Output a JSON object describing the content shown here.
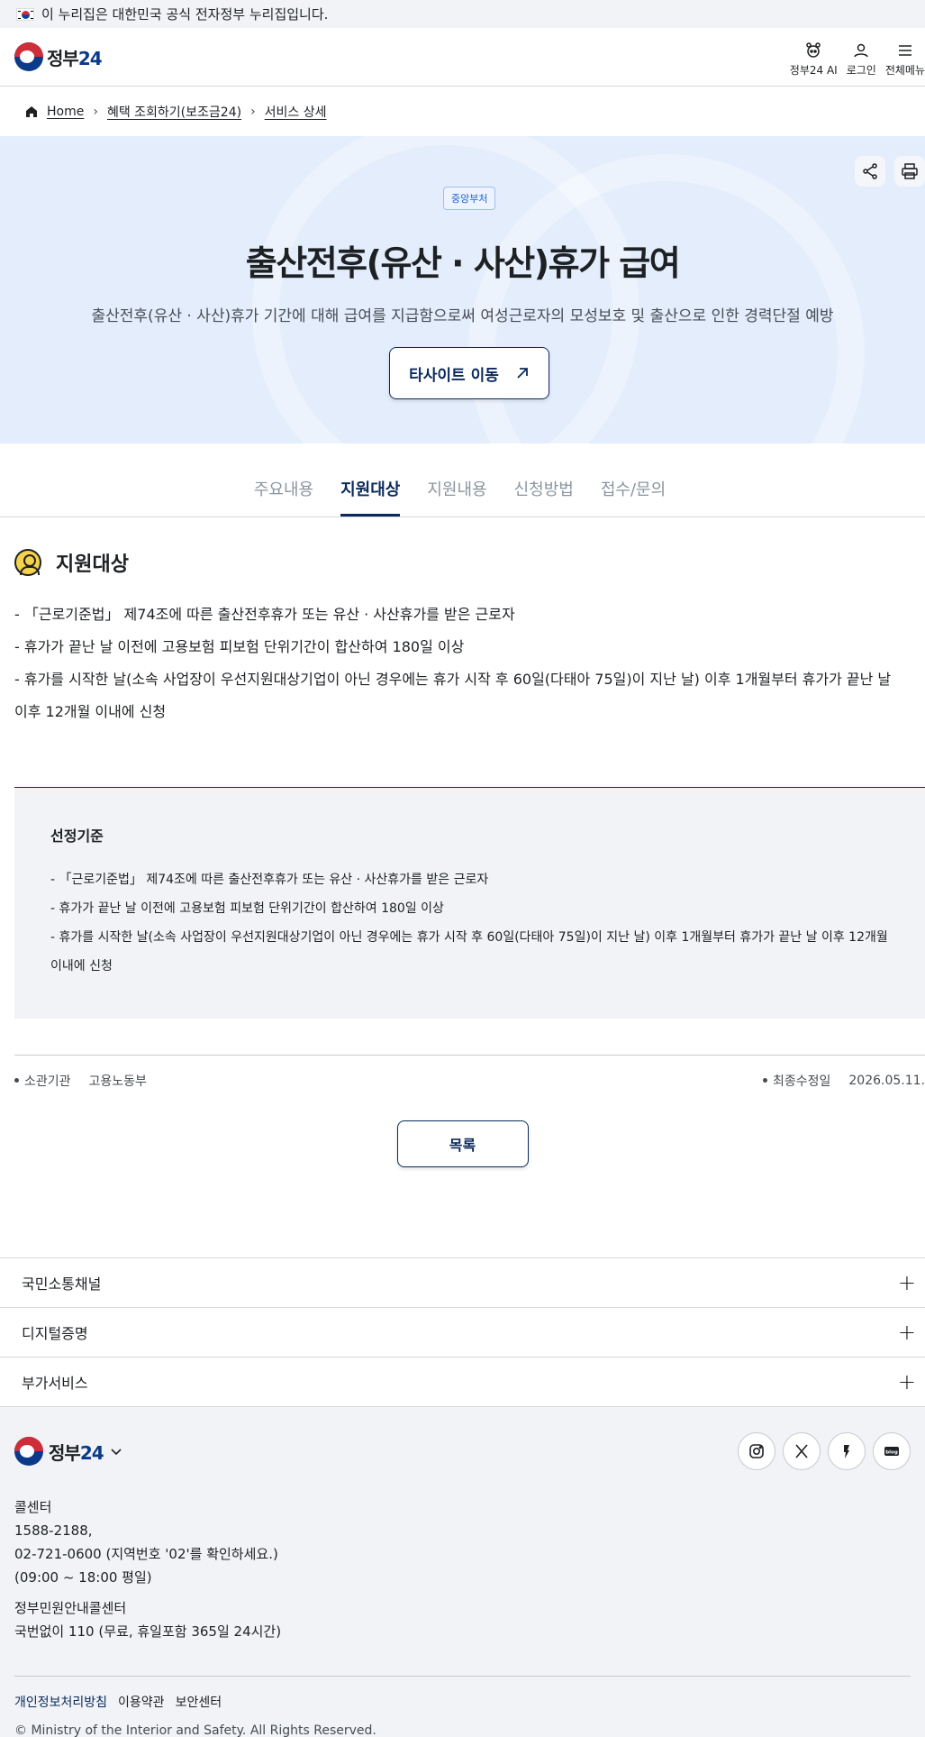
{
  "banner": {
    "text": "이 누리집은 대한민국 공식 전자정부 누리집입니다."
  },
  "header": {
    "logo_text": "정부",
    "logo_num": "24",
    "actions": [
      {
        "label": "정부24 AI",
        "icon": "ai-robot-icon"
      },
      {
        "label": "로그인",
        "icon": "user-icon"
      },
      {
        "label": "전체메뉴",
        "icon": "menu-icon"
      }
    ]
  },
  "breadcrumb": {
    "home": "Home",
    "level1": "혜택 조회하기(보조금24)",
    "level2": "서비스 상세"
  },
  "hero": {
    "badge": "중앙부처",
    "title": "출산전후(유산 · 사산)휴가 급여",
    "description": "출산전후(유산 · 사산)휴가 기간에 대해 급여를 지급함으로써 여성근로자의 모성보호 및 출산으로 인한 경력단절 예방",
    "button": "타사이트 이동"
  },
  "tabs": [
    {
      "label": "주요내용",
      "active": false
    },
    {
      "label": "지원대상",
      "active": true
    },
    {
      "label": "지원내용",
      "active": false
    },
    {
      "label": "신청방법",
      "active": false
    },
    {
      "label": "접수/문의",
      "active": false
    }
  ],
  "section": {
    "title": "지원대상",
    "items": [
      "- 「근로기준법」 제74조에 따른 출산전후휴가 또는 유산 · 사산휴가를 받은 근로자",
      "- 휴가가 끝난 날 이전에 고용보험 피보험 단위기간이 합산하여 180일 이상",
      "- 휴가를 시작한 날(소속 사업장이 우선지원대상기업이 아닌 경우에는 휴가 시작 후 60일(다태아 75일)이 지난 날) 이후 1개월부터 휴가가 끝난 날 이후 12개월 이내에 신청"
    ]
  },
  "criteria": {
    "title": "선정기준",
    "items": [
      "- 「근로기준법」 제74조에 따른 출산전후휴가 또는 유산 · 사산휴가를 받은 근로자",
      "- 휴가가 끝난 날 이전에 고용보험 피보험 단위기간이 합산하여 180일 이상",
      "- 휴가를 시작한 날(소속 사업장이 우선지원대상기업이 아닌 경우에는 휴가 시작 후 60일(다태아 75일)이 지난 날) 이후 1개월부터 휴가가 끝난 날 이후 12개월 이내에 신청"
    ]
  },
  "meta": {
    "agency_label": "소관기관",
    "agency_value": "고용노동부",
    "updated_label": "최종수정일",
    "updated_value": "2026.05.11."
  },
  "list_button": "목록",
  "accordion": [
    "국민소통채널",
    "디지털증명",
    "부가서비스"
  ],
  "footer": {
    "call_center_title": "콜센터",
    "call_line1": "1588-2188,",
    "call_line2": "02-721-0600 (지역번호 '02'를 확인하세요.)",
    "call_hours": "(09:00 ~ 18:00 평일)",
    "gov_center_title": "정부민원안내콜센터",
    "gov_center_line": "국번없이 110 (무료, 휴일포함 365일 24시간)",
    "links": [
      "개인정보처리방침",
      "이용약관",
      "보안센터"
    ],
    "copyright": "© Ministry of the Interior and Safety. All Rights Reserved.",
    "socials": [
      "instagram-icon",
      "x-icon",
      "kakao-story-icon",
      "blog-icon"
    ]
  }
}
